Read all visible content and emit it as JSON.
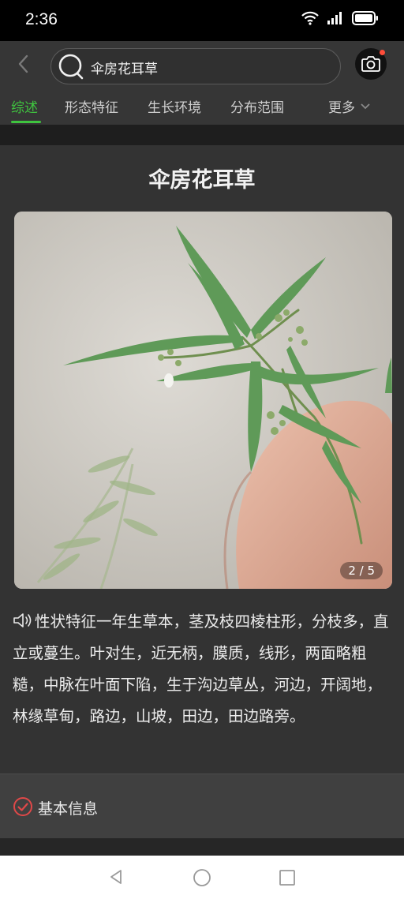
{
  "status": {
    "time": "2:36"
  },
  "search": {
    "query": "伞房花耳草"
  },
  "tabs": [
    {
      "label": "综述"
    },
    {
      "label": "形态特征"
    },
    {
      "label": "生长环境"
    },
    {
      "label": "分布范围"
    },
    {
      "label": "更多"
    }
  ],
  "plant": {
    "name": "伞房花耳草",
    "photo_counter": "2 / 5",
    "description": "性状特征一年生草本，茎及枝四棱柱形，分枝多，直立或蔓生。叶对生，近无柄，膜质，线形，两面略粗糙，中脉在叶面下陷，生于沟边草丛，河边，开阔地，林缘草甸，路边，山坡，田边，田边路旁。"
  },
  "info_section": {
    "label": "基本信息"
  },
  "colors": {
    "accent": "#3fc43f",
    "info_icon": "#e04848",
    "background": "#2b2b2b"
  },
  "icons": [
    "back-arrow-icon",
    "search-icon",
    "camera-icon",
    "chevron-down-icon",
    "speaker-icon",
    "check-circle-icon",
    "nav-back-icon",
    "nav-home-icon",
    "nav-recent-icon"
  ]
}
